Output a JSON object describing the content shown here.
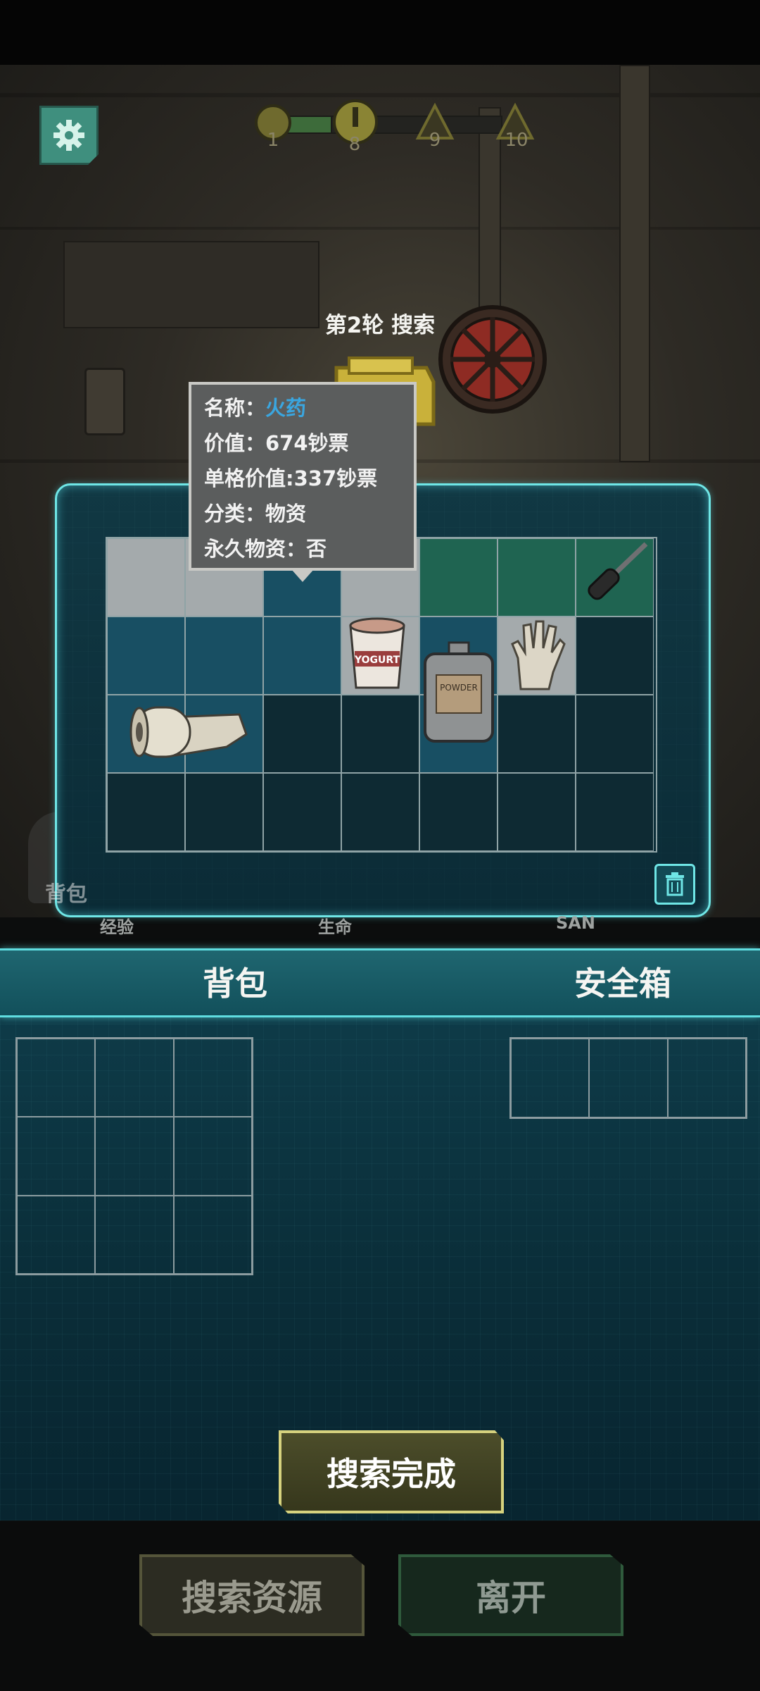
{
  "hud": {
    "stages": [
      "1",
      "8",
      "9",
      "10"
    ],
    "round_title": "第2轮 搜索"
  },
  "tooltip": {
    "name_label": "名称：",
    "name_value": "火药",
    "value_row": "价值：674钞票",
    "unit_value_row": "单格价值:337钞票",
    "category_row": "分类：物资",
    "permanent_row": "永久物资：否"
  },
  "container": {
    "items": [
      "tape-roll",
      "yogurt-cup",
      "powder-flask",
      "work-glove",
      "screwdriver"
    ],
    "partial_label": "背包"
  },
  "background_stats": {
    "exp_label": "经验",
    "hp_label": "生命",
    "san_label": "SAN"
  },
  "inventory": {
    "backpack_label": "背包",
    "safebox_label": "安全箱"
  },
  "buttons": {
    "search_done": "搜索完成",
    "search_resources": "搜索资源",
    "leave": "离开"
  },
  "colors": {
    "accent_cyan": "#6fe6e6",
    "tooltip_highlight": "#3aa6e0",
    "button_gold": "#d6d27e"
  }
}
